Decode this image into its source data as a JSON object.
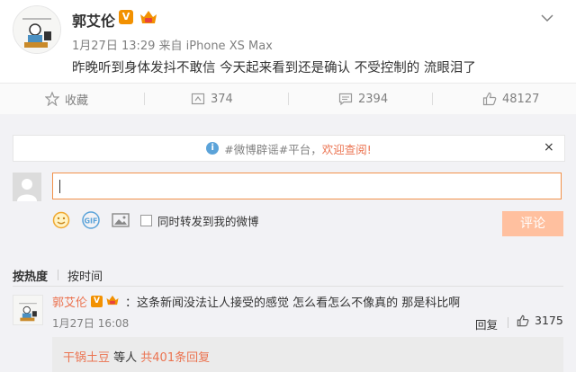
{
  "post": {
    "author": "郭艾伦",
    "verified_badge": "V",
    "meta": "1月27日 13:29 来自 iPhone XS Max",
    "text": "昨晚听到身体发抖不敢信 今天起来看到还是确认 不受控制的 流眼泪了"
  },
  "actions": {
    "favorite_label": "收藏",
    "repost_count": "374",
    "comment_count": "2394",
    "like_count": "48127"
  },
  "comment_box": {
    "notice_text": "#微博辟谣#平台，",
    "notice_link": "欢迎查阅!",
    "close_symbol": "×",
    "repost_option": "同时转发到我的微博",
    "submit_label": "评论",
    "gif_label": "GIF"
  },
  "sort": {
    "hot": "按热度",
    "time": "按时间"
  },
  "comment": {
    "author": "郭艾伦",
    "verified_badge": "V",
    "text": "：这条新闻没法让人接受的感觉 怎么看怎么不像真的 那是科比啊",
    "date": "1月27日 16:08",
    "reply_label": "回复",
    "likes": "3175",
    "sub": {
      "name": "干锅土豆",
      "middle": " 等人 ",
      "count_text": "共401条回复"
    }
  },
  "colors": {
    "accent": "#eb7350",
    "verify": "#f29101",
    "submit_disabled": "#ffc09f",
    "input_border": "#f2914a"
  }
}
